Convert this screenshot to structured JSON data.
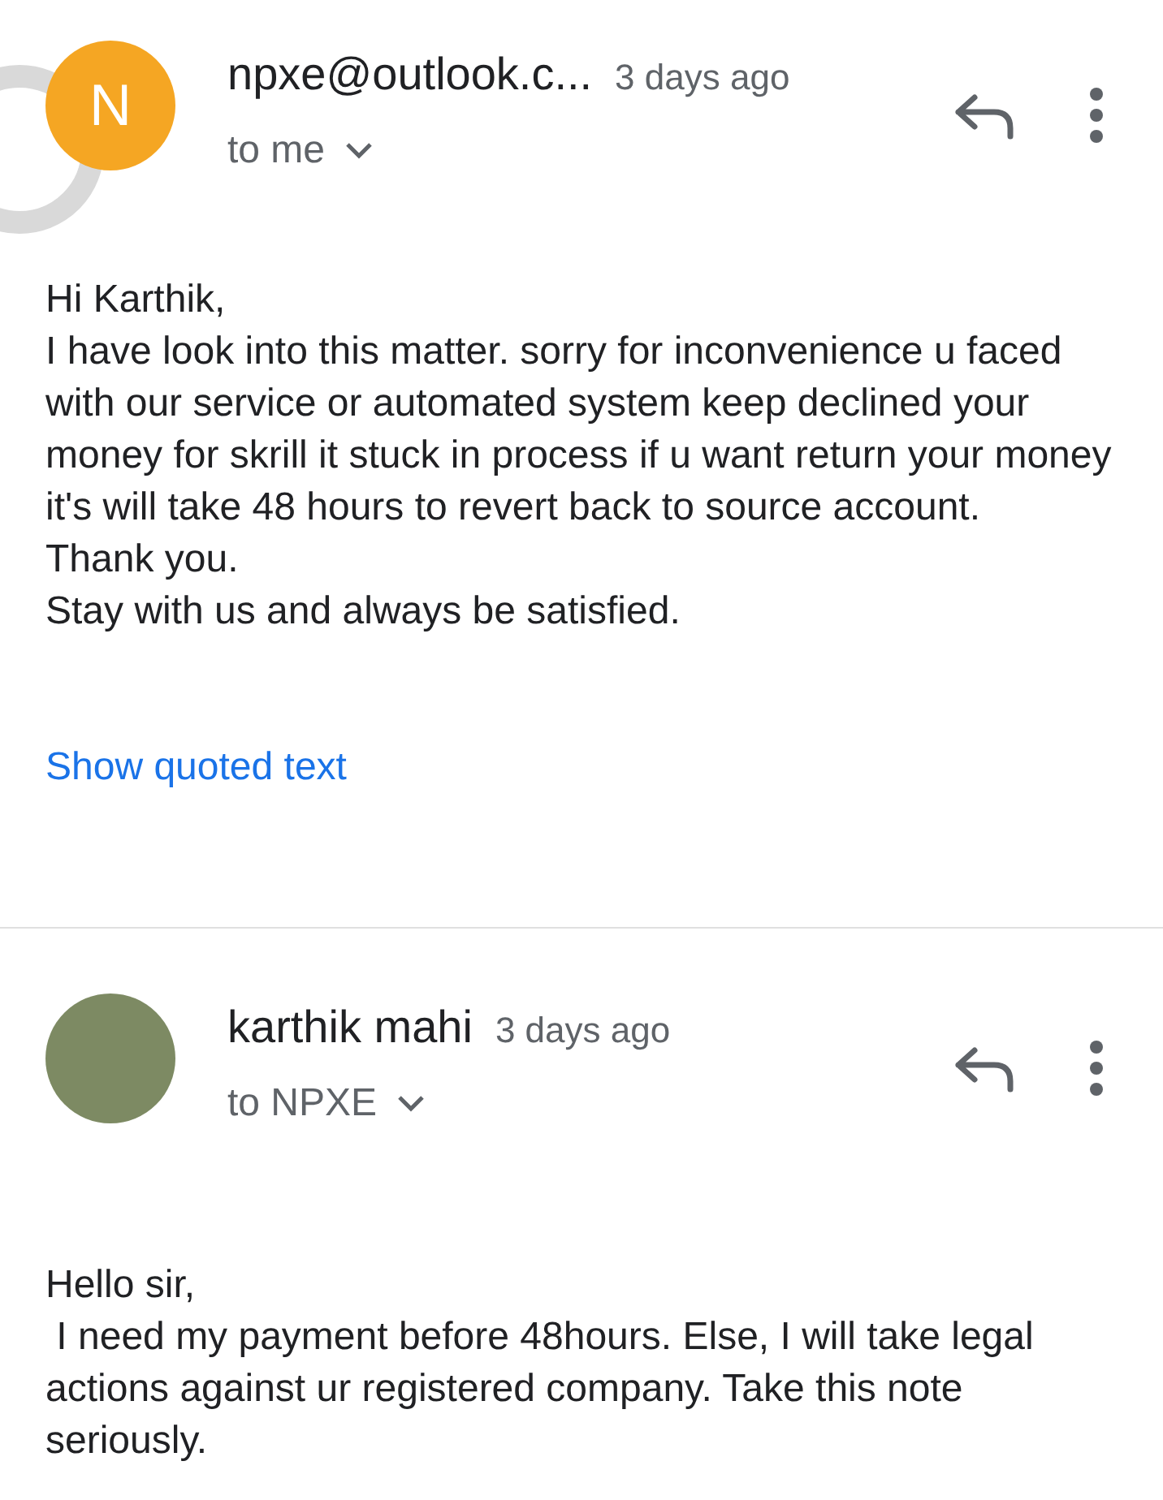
{
  "messages": [
    {
      "sender": "npxe@outlook.c...",
      "time": "3 days ago",
      "recipient": "to me",
      "avatar": {
        "kind": "letter",
        "letter": "N"
      },
      "body": [
        "Hi Karthik,",
        "I have look into this matter. sorry for inconvenience u faced with our service or automated system keep declined your money for skrill it stuck in process if u want return your money it's will take 48 hours to revert back to source account.",
        "Thank you.",
        "Stay with us and always be satisfied."
      ],
      "quoted_link": "Show quoted text"
    },
    {
      "sender": "karthik mahi",
      "time": "3 days ago",
      "recipient": "to NPXE",
      "avatar": {
        "kind": "photo"
      },
      "body": [
        "Hello sir,",
        " I need my payment before 48hours. Else, I will take legal actions against ur registered company. Take this note seriously."
      ]
    }
  ]
}
